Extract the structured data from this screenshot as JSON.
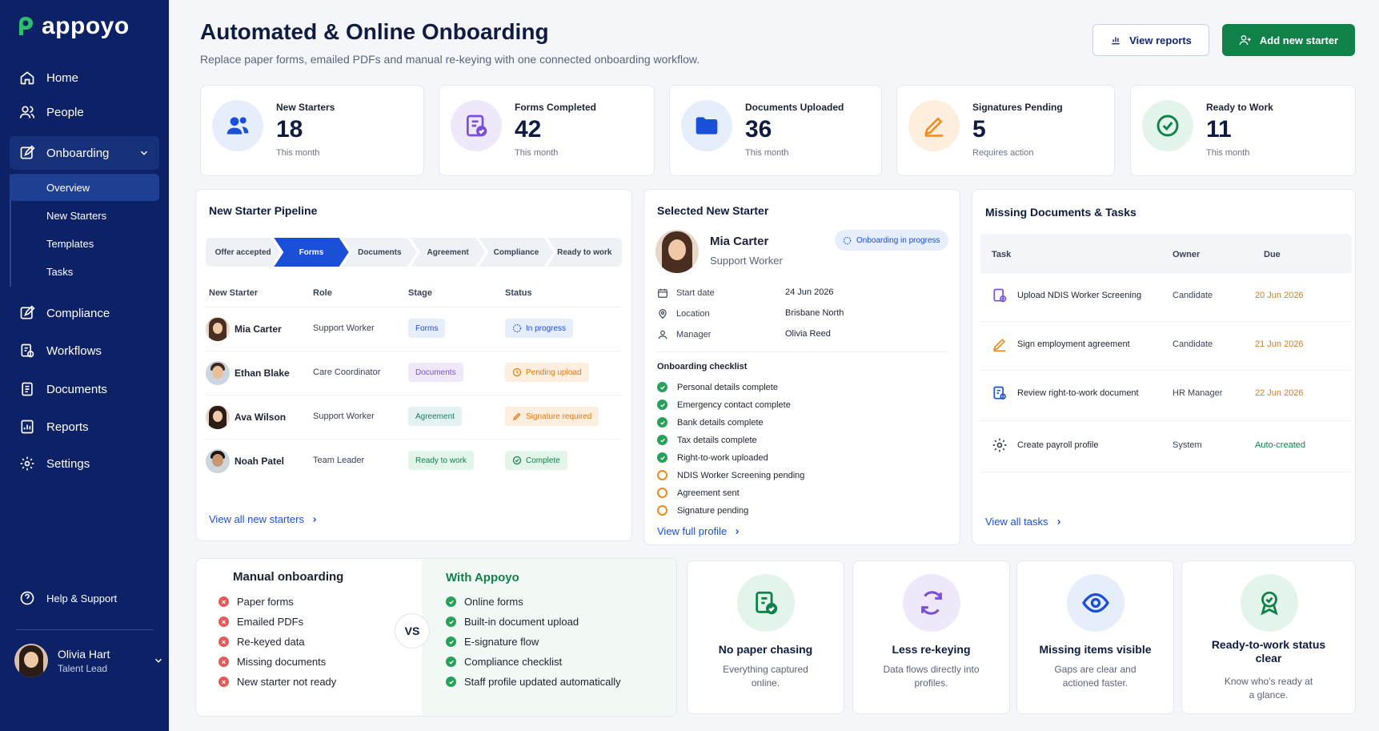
{
  "brand": {
    "name": "appoyo",
    "accent": "#11814a",
    "primary": "#1a4fd8",
    "sidebar_bg": "#0d2266"
  },
  "nav": {
    "home": "Home",
    "people": "People",
    "onboarding": "Onboarding",
    "sub": [
      "Overview",
      "New Starters",
      "Templates",
      "Tasks"
    ],
    "compliance": "Compliance",
    "workflows": "Workflows",
    "documents": "Documents",
    "reports": "Reports",
    "settings": "Settings",
    "help": "Help & Support"
  },
  "user": {
    "name": "Olivia Hart",
    "role": "Talent Lead"
  },
  "header": {
    "title": "Automated & Online Onboarding",
    "subtitle": "Replace paper forms, emailed PDFs and manual re-keying with one connected onboarding workflow.",
    "view_reports": "View reports",
    "add_starter": "Add new starter"
  },
  "stats": [
    {
      "label": "New Starters",
      "value": "18",
      "note": "This month"
    },
    {
      "label": "Forms Completed",
      "value": "42",
      "note": "This month"
    },
    {
      "label": "Documents Uploaded",
      "value": "36",
      "note": "This month"
    },
    {
      "label": "Signatures Pending",
      "value": "5",
      "note": "Requires action"
    },
    {
      "label": "Ready to Work",
      "value": "11",
      "note": "This month"
    }
  ],
  "pipeline": {
    "title": "New Starter Pipeline",
    "stages": [
      "Offer accepted",
      "Forms",
      "Documents",
      "Agreement",
      "Compliance",
      "Ready to work"
    ],
    "columns": [
      "New Starter",
      "Role",
      "Stage",
      "Status"
    ],
    "rows": [
      {
        "name": "Mia Carter",
        "role": "Support Worker",
        "stage": "Forms",
        "status": "In progress"
      },
      {
        "name": "Ethan Blake",
        "role": "Care Coordinator",
        "stage": "Documents",
        "status": "Pending upload"
      },
      {
        "name": "Ava Wilson",
        "role": "Support Worker",
        "stage": "Agreement",
        "status": "Signature required"
      },
      {
        "name": "Noah Patel",
        "role": "Team Leader",
        "stage": "Ready to work",
        "status": "Complete"
      }
    ],
    "link": "View all new starters"
  },
  "selected": {
    "title": "Selected New Starter",
    "name": "Mia Carter",
    "role": "Support Worker",
    "badge": "Onboarding in progress",
    "details": [
      {
        "label": "Start date",
        "value": "24 Jun 2026"
      },
      {
        "label": "Location",
        "value": "Brisbane North"
      },
      {
        "label": "Manager",
        "value": "Olivia Reed"
      }
    ],
    "checklist_title": "Onboarding checklist",
    "checklist": [
      {
        "text": "Personal details complete",
        "done": true
      },
      {
        "text": "Emergency contact complete",
        "done": true
      },
      {
        "text": "Bank details complete",
        "done": true
      },
      {
        "text": "Tax details complete",
        "done": true
      },
      {
        "text": "Right-to-work uploaded",
        "done": true
      },
      {
        "text": "NDIS Worker Screening pending",
        "done": false
      },
      {
        "text": "Agreement sent",
        "done": false
      },
      {
        "text": "Signature pending",
        "done": false
      }
    ],
    "link": "View full profile"
  },
  "missing": {
    "title": "Missing Documents & Tasks",
    "columns": [
      "Task",
      "Owner",
      "Due"
    ],
    "rows": [
      {
        "task": "Upload NDIS Worker Screening",
        "owner": "Candidate",
        "due": "20 Jun 2026"
      },
      {
        "task": "Sign employment agreement",
        "owner": "Candidate",
        "due": "21 Jun 2026"
      },
      {
        "task": "Review right-to-work document",
        "owner": "HR Manager",
        "due": "22 Jun 2026"
      },
      {
        "task": "Create payroll profile",
        "owner": "System",
        "due": "Auto-created"
      }
    ],
    "link": "View all tasks"
  },
  "compare": {
    "manual_title": "Manual onboarding",
    "manual": [
      "Paper forms",
      "Emailed PDFs",
      "Re-keyed data",
      "Missing documents",
      "New starter not ready"
    ],
    "vs": "VS",
    "appoyo_title": "With Appoyo",
    "appoyo": [
      "Online forms",
      "Built-in document upload",
      "E-signature flow",
      "Compliance checklist",
      "Staff profile updated automatically"
    ]
  },
  "features": [
    {
      "title": "No paper chasing",
      "desc": "Everything captured online."
    },
    {
      "title": "Less re-keying",
      "desc": "Data flows directly into profiles."
    },
    {
      "title": "Missing items visible",
      "desc": "Gaps are clear and actioned faster."
    },
    {
      "title": "Ready-to-work status clear",
      "desc": "Know who's ready at a glance."
    }
  ]
}
